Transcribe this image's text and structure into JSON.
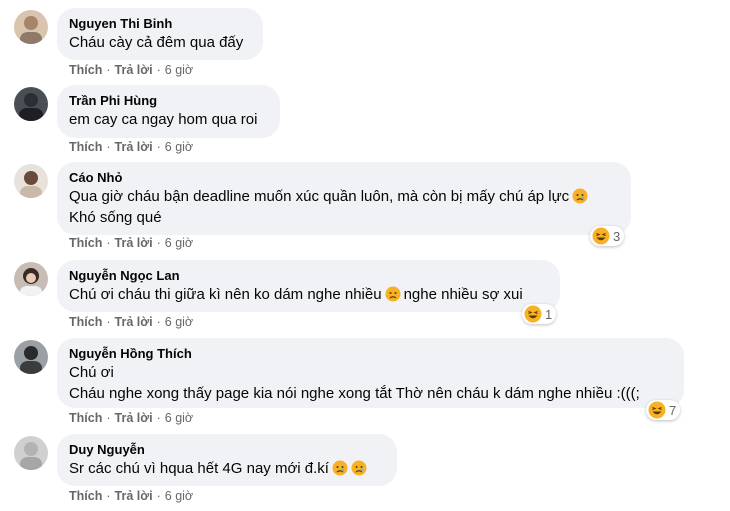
{
  "actions": {
    "like": "Thích",
    "reply": "Trả lời",
    "dot": "·"
  },
  "comments": [
    {
      "author": "Nguyen Thi Binh",
      "lines": [
        "Cháu cày cả đêm qua đấy"
      ],
      "time": "6 giờ"
    },
    {
      "author": "Trần Phi Hùng",
      "lines": [
        "em cay ca ngay hom qua roi"
      ],
      "time": "6 giờ"
    },
    {
      "author": "Cáo Nhỏ",
      "line1": "Qua giờ cháu bận deadline muốn xúc quần luôn, mà còn bị mấy chú áp lực",
      "line2": "Khó sống qué",
      "time": "6 giờ",
      "reaction_icon": "haha-icon",
      "reaction_count": "3"
    },
    {
      "author": "Nguyễn Ngọc Lan",
      "line1a": "Chú ơi cháu thi giữa kì nên ko dám nghe nhiều",
      "line1b": "nghe nhiều sợ xui",
      "time": "6 giờ",
      "reaction_icon": "haha-icon",
      "reaction_count": "1"
    },
    {
      "author": "Nguyễn Hồng Thích",
      "line1": "Chú ơi",
      "line2": "Cháu nghe xong thấy page kia nói nghe xong tắt Thờ nên cháu k dám nghe nhiều :(((;",
      "time": "6 giờ",
      "reaction_icon": "haha-icon",
      "reaction_count": "7"
    },
    {
      "author": "Duy Nguyễn",
      "line1": "Sr các chú vì hqua hết 4G nay mới đ.kí",
      "time": "6 giờ"
    }
  ],
  "colors": {
    "bubble": "#f0f2f5",
    "meta": "#65676b",
    "text": "#050505",
    "emoji": "#f7b125"
  }
}
